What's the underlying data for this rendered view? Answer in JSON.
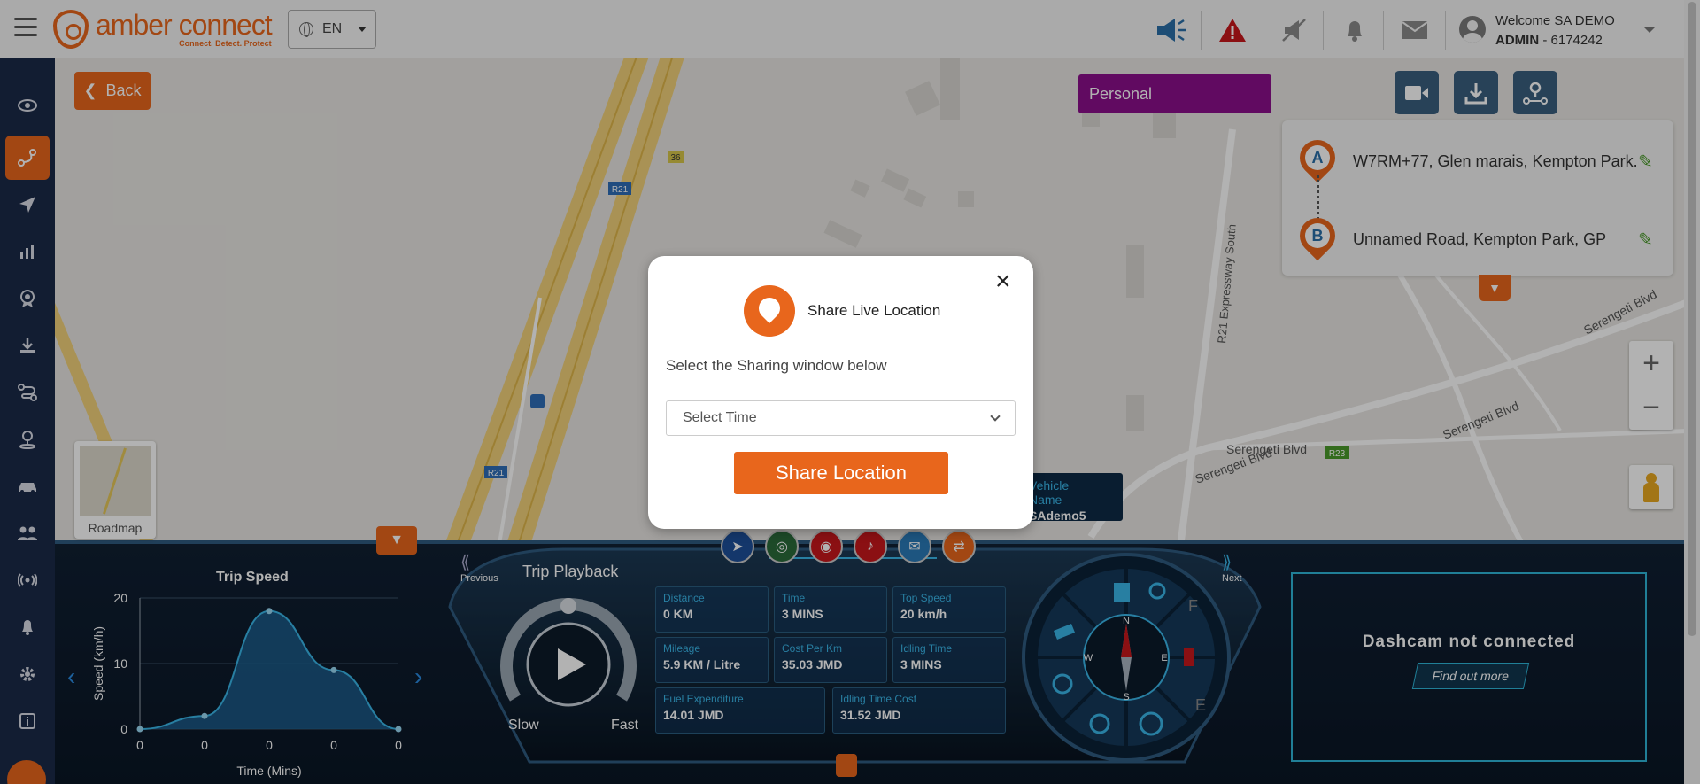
{
  "topbar": {
    "logo_name": "amber connect",
    "logo_tagline": "Connect. Detect. Protect",
    "language": "EN",
    "welcome": "Welcome SA DEMO",
    "user_role": "ADMIN",
    "user_id": "- 6174242",
    "icons": [
      "megaphone-icon",
      "alert-triangle-icon",
      "mute-icon",
      "bell-muted-icon",
      "mail-icon",
      "user-icon"
    ]
  },
  "sidebar": {
    "items": [
      "eye-icon",
      "trip-route-icon",
      "navigate-icon",
      "analytics-icon",
      "badge-icon",
      "download-icon",
      "route-icon",
      "location-pin-icon",
      "vehicle-icon",
      "users-icon",
      "signal-icon",
      "bell-icon",
      "settings-icon",
      "info-icon"
    ],
    "active": "trip-route-icon"
  },
  "map": {
    "back_label": "Back",
    "personal_label": "Personal",
    "roadmap_label": "Roadmap",
    "labels": {
      "r21_a": "R21",
      "r21_b": "R21",
      "route_36": "36",
      "r23": "R23",
      "serengeti_1": "Serengeti Blvd",
      "serengeti_2": "Serengeti Blvd",
      "serengeti_3": "Serengeti Blvd",
      "serengeti_4": "Serengeti Blvd",
      "r21_express": "R21 Expressway South"
    },
    "zoom_in": "+",
    "zoom_out": "−"
  },
  "route": {
    "a_label": "A",
    "a_address": "W7RM+77, Glen marais, Kempton Park.",
    "b_label": "B",
    "b_address": "Unnamed Road, Kempton Park, GP"
  },
  "vehicle": {
    "label": "Vehicle Name",
    "name": "SAdemo5"
  },
  "trip_speed": {
    "title": "Trip Speed"
  },
  "chart_data": {
    "type": "area",
    "title": "Trip Speed",
    "xlabel": "Time (Mins)",
    "ylabel": "Speed (km/h)",
    "categories": [
      "0",
      "0",
      "0",
      "0",
      "0"
    ],
    "values": [
      0,
      2,
      18,
      9,
      0
    ],
    "ylim": [
      0,
      20
    ],
    "yticks": [
      0,
      10,
      20
    ],
    "grid": true
  },
  "playback": {
    "title": "Trip Playback",
    "previous": "Previous",
    "next": "Next",
    "slow": "Slow",
    "fast": "Fast"
  },
  "stats": {
    "distance": {
      "k": "Distance",
      "v": "0 KM"
    },
    "time": {
      "k": "Time",
      "v": "3 MINS"
    },
    "top_speed": {
      "k": "Top Speed",
      "v": "20 km/h"
    },
    "mileage": {
      "k": "Mileage",
      "v": "5.9 KM / Litre"
    },
    "cost_per_km": {
      "k": "Cost Per Km",
      "v": "35.03 JMD"
    },
    "idling_time": {
      "k": "Idling Time",
      "v": "3 MINS"
    },
    "fuel_exp": {
      "k": "Fuel Expenditure",
      "v": "14.01 JMD"
    },
    "idling_cost": {
      "k": "Idling Time Cost",
      "v": "31.52 JMD"
    }
  },
  "compass": {
    "n": "N",
    "s": "S",
    "e": "E",
    "w": "W",
    "f": "F",
    "e2": "E"
  },
  "dashcam": {
    "title": "Dashcam not connected",
    "button": "Find out more"
  },
  "modal": {
    "title": "Share Live Location",
    "subtitle": "Select the Sharing window below",
    "select_placeholder": "Select Time",
    "share_button": "Share Location",
    "close": "×"
  },
  "colors": {
    "brand": "#e8661c",
    "sidebar": "#1b2a48",
    "personal": "#8b0f8b",
    "dash_accent": "#3ab6e8"
  }
}
